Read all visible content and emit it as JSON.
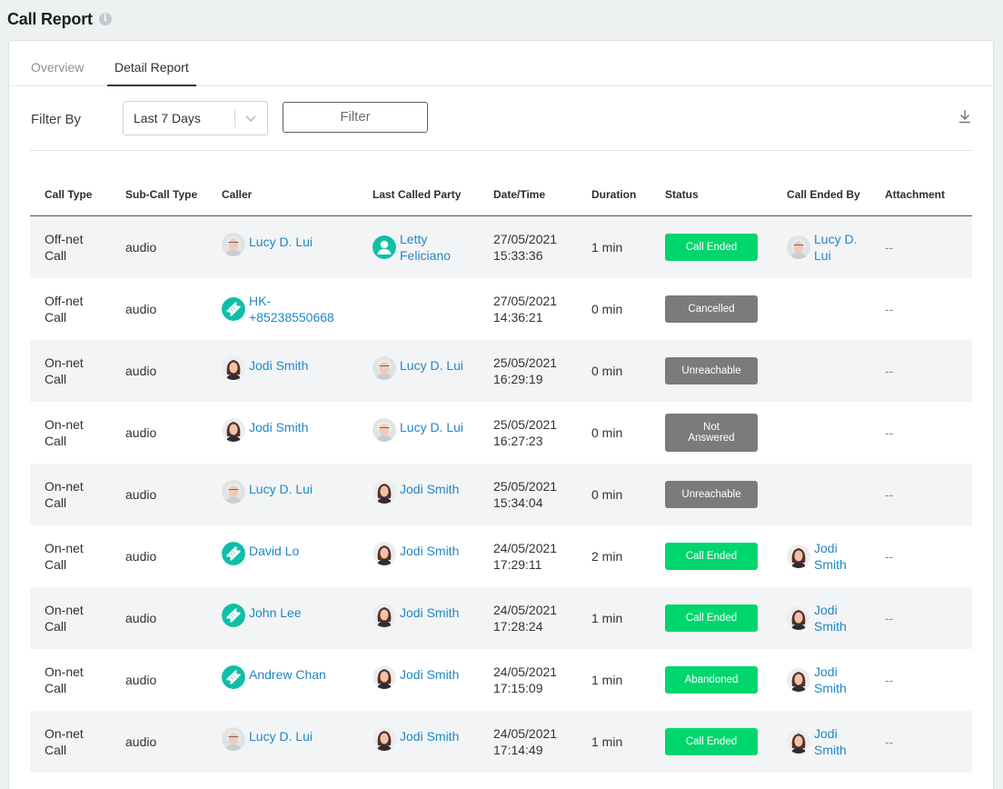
{
  "page": {
    "title": "Call Report",
    "info_icon": "i"
  },
  "tabs": [
    {
      "label": "Overview",
      "active": false
    },
    {
      "label": "Detail Report",
      "active": true
    }
  ],
  "filter": {
    "label": "Filter By",
    "select_value": "Last 7 Days",
    "button_label": "Filter",
    "download_icon": "download-icon"
  },
  "colors": {
    "green_status": "#00d66e",
    "grey_status": "#797b7c",
    "link": "#1f87c7",
    "accent": "#0fbfa8"
  },
  "table": {
    "columns": [
      "Call Type",
      "Sub-Call Type",
      "Caller",
      "Last Called Party",
      "Date/Time",
      "Duration",
      "Status",
      "Call Ended By",
      "Attachment"
    ],
    "rows": [
      {
        "call_type": [
          "Off-net",
          "Call"
        ],
        "sub_type": "audio",
        "caller": {
          "name": [
            "Lucy D. Lui"
          ],
          "icon": "lucy-avatar"
        },
        "last_party": {
          "name": [
            "Letty",
            "Feliciano"
          ],
          "icon": "person-icon"
        },
        "datetime": [
          "27/05/2021",
          "15:33:36"
        ],
        "duration": "1 min",
        "status": "Call Ended",
        "status_color": "green",
        "ended_by": {
          "name": [
            "Lucy D.",
            "Lui"
          ],
          "icon": "lucy-avatar"
        },
        "attachment": "--"
      },
      {
        "call_type": [
          "Off-net",
          "Call"
        ],
        "sub_type": "audio",
        "caller": {
          "name": [
            "HK-",
            "+85238550668"
          ],
          "icon": "ticket-icon"
        },
        "last_party": null,
        "datetime": [
          "27/05/2021",
          "14:36:21"
        ],
        "duration": "0 min",
        "status": "Cancelled",
        "status_color": "grey",
        "ended_by": null,
        "attachment": "--"
      },
      {
        "call_type": [
          "On-net",
          "Call"
        ],
        "sub_type": "audio",
        "caller": {
          "name": [
            "Jodi Smith"
          ],
          "icon": "jodi-avatar"
        },
        "last_party": {
          "name": [
            "Lucy D. Lui"
          ],
          "icon": "lucy-avatar"
        },
        "datetime": [
          "25/05/2021",
          "16:29:19"
        ],
        "duration": "0 min",
        "status": "Unreachable",
        "status_color": "grey",
        "ended_by": null,
        "attachment": "--"
      },
      {
        "call_type": [
          "On-net",
          "Call"
        ],
        "sub_type": "audio",
        "caller": {
          "name": [
            "Jodi Smith"
          ],
          "icon": "jodi-avatar"
        },
        "last_party": {
          "name": [
            "Lucy D. Lui"
          ],
          "icon": "lucy-avatar"
        },
        "datetime": [
          "25/05/2021",
          "16:27:23"
        ],
        "duration": "0 min",
        "status": "Not Answered",
        "status_color": "grey",
        "ended_by": null,
        "attachment": "--"
      },
      {
        "call_type": [
          "On-net",
          "Call"
        ],
        "sub_type": "audio",
        "caller": {
          "name": [
            "Lucy D. Lui"
          ],
          "icon": "lucy-avatar"
        },
        "last_party": {
          "name": [
            "Jodi Smith"
          ],
          "icon": "jodi-avatar"
        },
        "datetime": [
          "25/05/2021",
          "15:34:04"
        ],
        "duration": "0 min",
        "status": "Unreachable",
        "status_color": "grey",
        "ended_by": null,
        "attachment": "--"
      },
      {
        "call_type": [
          "On-net",
          "Call"
        ],
        "sub_type": "audio",
        "caller": {
          "name": [
            "David Lo"
          ],
          "icon": "ticket-icon"
        },
        "last_party": {
          "name": [
            "Jodi Smith"
          ],
          "icon": "jodi-avatar"
        },
        "datetime": [
          "24/05/2021",
          "17:29:11"
        ],
        "duration": "2 min",
        "status": "Call Ended",
        "status_color": "green",
        "ended_by": {
          "name": [
            "Jodi",
            "Smith"
          ],
          "icon": "jodi-avatar"
        },
        "attachment": "--"
      },
      {
        "call_type": [
          "On-net",
          "Call"
        ],
        "sub_type": "audio",
        "caller": {
          "name": [
            "John Lee"
          ],
          "icon": "ticket-icon"
        },
        "last_party": {
          "name": [
            "Jodi Smith"
          ],
          "icon": "jodi-avatar"
        },
        "datetime": [
          "24/05/2021",
          "17:28:24"
        ],
        "duration": "1 min",
        "status": "Call Ended",
        "status_color": "green",
        "ended_by": {
          "name": [
            "Jodi",
            "Smith"
          ],
          "icon": "jodi-avatar"
        },
        "attachment": "--"
      },
      {
        "call_type": [
          "On-net",
          "Call"
        ],
        "sub_type": "audio",
        "caller": {
          "name": [
            "Andrew Chan"
          ],
          "icon": "ticket-icon"
        },
        "last_party": {
          "name": [
            "Jodi Smith"
          ],
          "icon": "jodi-avatar"
        },
        "datetime": [
          "24/05/2021",
          "17:15:09"
        ],
        "duration": "1 min",
        "status": "Abandoned",
        "status_color": "green",
        "ended_by": {
          "name": [
            "Jodi",
            "Smith"
          ],
          "icon": "jodi-avatar"
        },
        "attachment": "--"
      },
      {
        "call_type": [
          "On-net",
          "Call"
        ],
        "sub_type": "audio",
        "caller": {
          "name": [
            "Lucy D. Lui"
          ],
          "icon": "lucy-avatar"
        },
        "last_party": {
          "name": [
            "Jodi Smith"
          ],
          "icon": "jodi-avatar"
        },
        "datetime": [
          "24/05/2021",
          "17:14:49"
        ],
        "duration": "1 min",
        "status": "Call Ended",
        "status_color": "green",
        "ended_by": {
          "name": [
            "Jodi",
            "Smith"
          ],
          "icon": "jodi-avatar"
        },
        "attachment": "--"
      }
    ]
  }
}
